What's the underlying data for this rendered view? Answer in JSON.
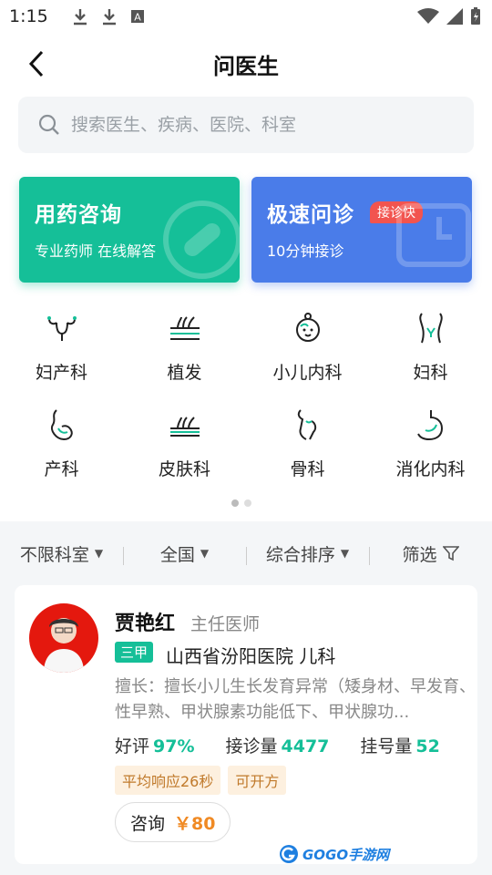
{
  "status_bar": {
    "time": "1:15"
  },
  "header": {
    "title": "问医生"
  },
  "search": {
    "placeholder": "搜索医生、疾病、医院、科室"
  },
  "service_cards": [
    {
      "title": "用药咨询",
      "subtitle": "专业药师  在线解答",
      "color": "#15bf98"
    },
    {
      "title": "极速问诊",
      "badge": "接诊快",
      "subtitle": "10分钟接诊",
      "color": "#4a7ce9"
    }
  ],
  "departments": [
    {
      "label": "妇产科",
      "icon": "uterus-icon"
    },
    {
      "label": "植发",
      "icon": "hair-icon"
    },
    {
      "label": "小儿内科",
      "icon": "baby-icon"
    },
    {
      "label": "妇科",
      "icon": "female-organ-icon"
    },
    {
      "label": "产科",
      "icon": "pregnant-icon"
    },
    {
      "label": "皮肤科",
      "icon": "skin-icon"
    },
    {
      "label": "骨科",
      "icon": "bone-icon"
    },
    {
      "label": "消化内科",
      "icon": "stomach-icon"
    }
  ],
  "filters": [
    {
      "label": "不限科室"
    },
    {
      "label": "全国"
    },
    {
      "label": "综合排序"
    },
    {
      "label": "筛选"
    }
  ],
  "doctor": {
    "name": "贾艳红",
    "title": "主任医师",
    "tier": "三甲",
    "hospital": "山西省汾阳医院 儿科",
    "specialty": "擅长：擅长小儿生长发育异常（矮身材、早发育、性早熟、甲状腺素功能低下、甲状腺功...",
    "good_label": "好评",
    "good_value": "97%",
    "consult_label": "接诊量",
    "consult_value": "4477",
    "reg_label": "挂号量",
    "reg_value": "52",
    "tags": [
      "平均响应26秒",
      "可开方"
    ],
    "consult_btn": "咨询",
    "price": "￥80"
  },
  "watermark": {
    "text": "GOGO手游网"
  },
  "colors": {
    "accent_green": "#15bf98",
    "accent_blue": "#4a7ce9",
    "badge_red": "#f2544f",
    "price_orange": "#f08a24"
  }
}
